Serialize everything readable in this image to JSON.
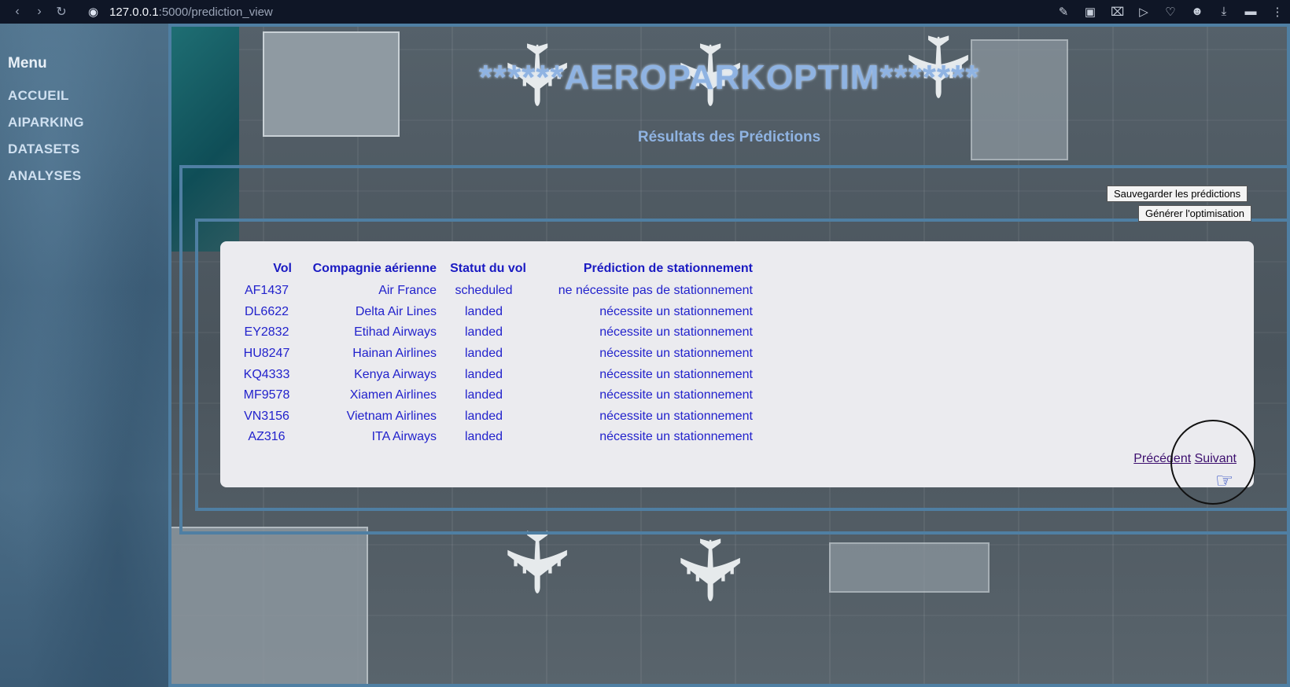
{
  "browser": {
    "url_host": "127.0.0.1",
    "url_path": ":5000/prediction_view",
    "icons": [
      "back-icon",
      "forward-icon",
      "reload-icon",
      "site-info-icon",
      "edit-icon",
      "screenshot-icon",
      "close-tab-icon",
      "send-icon",
      "heart-icon",
      "profile-icon",
      "download-icon",
      "toggle-icon",
      "menu-icon"
    ]
  },
  "sidebar": {
    "title": "Menu",
    "items": [
      {
        "label": "ACCUEIL"
      },
      {
        "label": "AIPARKING"
      },
      {
        "label": "DATASETS"
      },
      {
        "label": "ANALYSES"
      }
    ]
  },
  "header": {
    "title": "******AEROPARKOPTIM*******",
    "subtitle": "Résultats des Prédictions"
  },
  "actions": {
    "save_label": "Sauvegarder les prédictions",
    "optimize_label": "Générer l'optimisation"
  },
  "table": {
    "columns": [
      "Vol",
      "Compagnie aérienne",
      "Statut du vol",
      "Prédiction de stationnement"
    ],
    "rows": [
      [
        "AF1437",
        "Air France",
        "scheduled",
        "ne nécessite pas de stationnement"
      ],
      [
        "DL6622",
        "Delta Air Lines",
        "landed",
        "nécessite un stationnement"
      ],
      [
        "EY2832",
        "Etihad Airways",
        "landed",
        "nécessite un stationnement"
      ],
      [
        "HU8247",
        "Hainan Airlines",
        "landed",
        "nécessite un stationnement"
      ],
      [
        "KQ4333",
        "Kenya Airways",
        "landed",
        "nécessite un stationnement"
      ],
      [
        "MF9578",
        "Xiamen Airlines",
        "landed",
        "nécessite un stationnement"
      ],
      [
        "VN3156",
        "Vietnam Airlines",
        "landed",
        "nécessite un stationnement"
      ],
      [
        "AZ316",
        "ITA Airways",
        "landed",
        "nécessite un stationnement"
      ]
    ]
  },
  "pager": {
    "prev_label": "Précédent",
    "next_label": "Suivant"
  },
  "colors": {
    "title": "#8fb3e2",
    "table_text": "#2222cc",
    "panel_bg": "#ebebef",
    "frame": "#4f7fa3"
  }
}
